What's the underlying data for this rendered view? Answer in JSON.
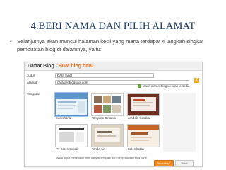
{
  "slide": {
    "title": "4.BERI NAMA DAN PILIH ALAMAT",
    "bullet_char": "•",
    "bullet_text": "Selanjutnya akan muncul halaman kecil yang mana terdapat 4 langkah singkat pembuatan blog di dalamnya, yaitu:"
  },
  "dialog": {
    "breadcrumb_root": "Daftar Blog",
    "breadcrumb_sep": "›",
    "breadcrumb_current": "Buat blog baru",
    "title_label": "Judul",
    "title_value": "Cara Sajel",
    "address_label": "Alamat",
    "address_value": "carasjel.blogspot.com",
    "availability_icon": "✓",
    "availability_text": "Maaf, alamat blog ini tidak tersedia.",
    "help_label": "?",
    "template_label": "Template",
    "templates": [
      {
        "name": "Sederhana",
        "selected": true
      },
      {
        "name": "Tampilan Dinamis",
        "selected": false
      },
      {
        "name": "Jendela Gambar",
        "selected": false
      },
      {
        "name": "PT Keren Sekali",
        "selected": false
      },
      {
        "name": "Tanda Air",
        "selected": false
      },
      {
        "name": "Kelembutan",
        "selected": false
      }
    ],
    "footnote": "Anda dapat menelusuri lebih banyak template dan menyesuaikan blog nanti.",
    "create_button": "Buat blog!",
    "cancel_button": "Batal"
  },
  "colors": {
    "title": "#1a3c66",
    "breadcrumb_accent": "#e26a17",
    "primary_button": "#f08a24",
    "help_badge": "#f2a616"
  }
}
